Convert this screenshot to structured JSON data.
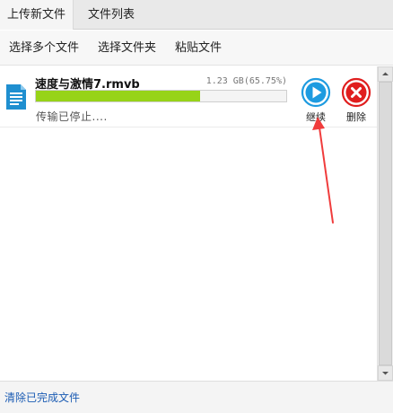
{
  "tabs": [
    {
      "label": "上传新文件",
      "active": true
    },
    {
      "label": "文件列表",
      "active": false
    }
  ],
  "toolbar": {
    "select_multiple": "选择多个文件",
    "select_folder": "选择文件夹",
    "paste_file": "粘贴文件"
  },
  "upload_item": {
    "file_name": "速度与激情7.rmvb",
    "size_text": "1.23 GB(65.75%)",
    "progress_percent": 65.75,
    "status": "传输已停止....",
    "icon": "document-icon",
    "actions": {
      "resume_label": "继续",
      "delete_label": "删除"
    }
  },
  "footer": {
    "clear_completed": "清除已完成文件"
  },
  "colors": {
    "progress_fill": "#97d318",
    "resume_blue": "#1e9be0",
    "delete_red": "#e01e1e",
    "annotation_arrow": "#f03c3c",
    "file_icon": "#1f8fd0",
    "footer_link": "#1a5bb3"
  }
}
